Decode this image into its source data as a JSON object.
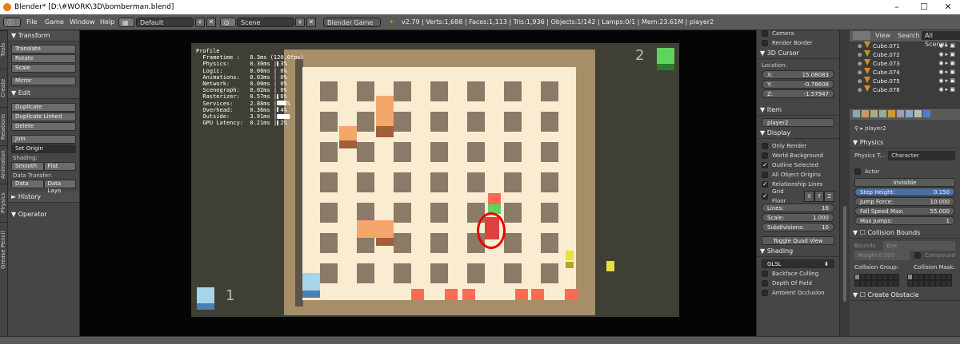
{
  "window": {
    "title": "Blender* [D:\\#WORK\\3D\\bomberman.blend]",
    "min": "–",
    "max": "☐",
    "close": "✕"
  },
  "menu": {
    "items": [
      "File",
      "Game",
      "Window",
      "Help"
    ],
    "screen": "Default",
    "scene": "Scene",
    "engine": "Blender Game",
    "stats": "v2.79 | Verts:1,688 | Faces:1,113 | Tris:1,936 | Objects:1/142 | Lamps:0/1 | Mem:23.61M | player2"
  },
  "tabs": [
    "Tools",
    "Create",
    "Relations",
    "Animation",
    "Physics",
    "Grease Pencil"
  ],
  "toolshelf": {
    "transform": "Transform",
    "translate": "Translate",
    "rotate": "Rotate",
    "scale": "Scale",
    "mirror": "Mirror",
    "edit": "Edit",
    "duplicate": "Duplicate",
    "duplicate_linked": "Duplicate Linked",
    "delete": "Delete",
    "join": "Join",
    "set_origin": "Set Origin",
    "shading": "Shading:",
    "smooth": "Smooth",
    "flat": "Flat",
    "data_transfer": "Data Transfer:",
    "data": "Data",
    "data_layo": "Data Layo",
    "history": "History",
    "operator": "Operator"
  },
  "profile": {
    "text": "Profile\n  Frametime :   8.3ms (120.0fps)\n  Physics:      0.30ms | 3%\n  Logic:        0.06ms | 0%\n  Animations:   0.03ms | 0%\n  Network:      0.00ms | 0%\n  Scenegraph:   0.02ms | 0%\n  Rasterizer:   0.57ms | 6%\n  Services:     2.88ms | 34%\n  Overhead:     0.36ms | 4%\n  Outside:      3.91ms | 46%\n  GPU Latency:  0.21ms | 2%",
    "bars": [
      3,
      0,
      0,
      0,
      0,
      6,
      34,
      4,
      46,
      2
    ]
  },
  "players": {
    "p1": "1",
    "p2": "2",
    "p1_color": "#a8d4e8",
    "p2_color": "#5fd35f"
  },
  "middle": {
    "camera": "Camera",
    "render_border": "Render Border",
    "cursor": "3D Cursor",
    "location": "Location:",
    "x_label": "X:",
    "x": "15.08083",
    "y_label": "Y:",
    "y": "-0.78608",
    "z_label": "Z:",
    "z": "-1.57947",
    "item": "Item",
    "item_name": "player2",
    "display": "Display",
    "only_render": "Only Render",
    "world_bg": "World Background",
    "outline": "Outline Selected",
    "all_origins": "All Object Origins",
    "rel_lines": "Relationship Lines",
    "grid_floor": "Grid Floor",
    "gx": "X",
    "gy": "Y",
    "gz": "Z",
    "lines_label": "Lines:",
    "lines": "16",
    "scale_label": "Scale:",
    "scale": "1.000",
    "subdiv_label": "Subdivisions:",
    "subdiv": "10",
    "quad": "Toggle Quad View",
    "shading": "Shading",
    "glsl": "GLSL",
    "backface": "Backface Culling",
    "dof": "Depth Of Field",
    "ao": "Ambient Occlusion"
  },
  "outliner": {
    "view": "View",
    "search": "Search",
    "all_scenes": "All Scenes",
    "items": [
      "Cube.071",
      "Cube.072",
      "Cube.073",
      "Cube.074",
      "Cube.075",
      "Cube.078"
    ]
  },
  "props": {
    "obj": "player2",
    "physics": "Physics",
    "type_label": "Physics T...",
    "type": "Character",
    "actor": "Actor",
    "invisible": "Invisible",
    "step_label": "Step Height:",
    "step": "0.150",
    "jump_label": "Jump Force:",
    "jump": "10.000",
    "fall_label": "Fall Speed Max:",
    "fall": "55.000",
    "jumps_label": "Max Jumps:",
    "jumps": "1",
    "collision": "Collision Bounds",
    "bounds_label": "Bounds:",
    "bounds": "Box",
    "margin": "Margin 0.000",
    "compound": "Compound",
    "cgroup": "Collision Group:",
    "cmask": "Collision Mask:",
    "obstacle": "Create Obstacle"
  }
}
